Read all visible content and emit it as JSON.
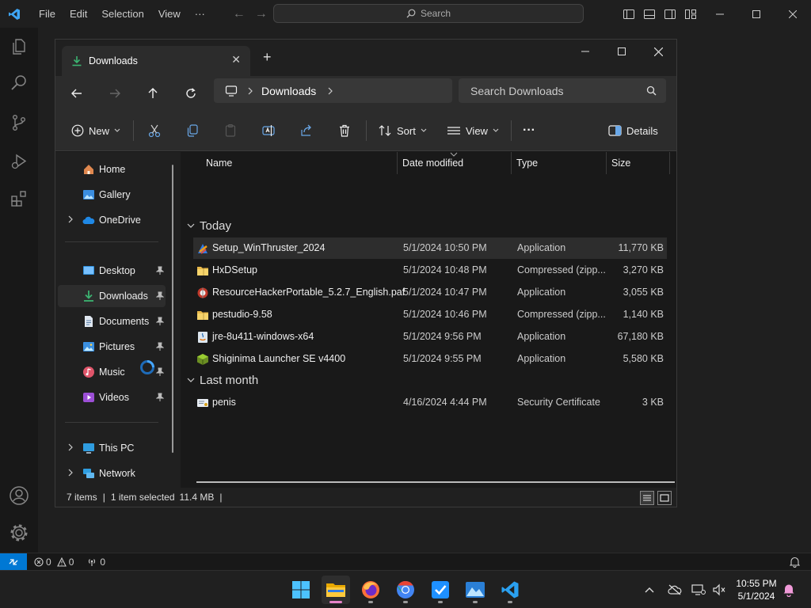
{
  "vscode": {
    "menu": [
      "File",
      "Edit",
      "Selection",
      "View",
      "···"
    ],
    "search_placeholder": "Search",
    "status": {
      "errors": "0",
      "warnings": "0",
      "ports": "0"
    }
  },
  "explorer": {
    "tab_title": "Downloads",
    "breadcrumb": "Downloads",
    "search_placeholder": "Search Downloads",
    "toolbar": {
      "new_label": "New",
      "sort_label": "Sort",
      "view_label": "View",
      "more_label": "···",
      "details_label": "Details"
    },
    "nav": {
      "home": "Home",
      "gallery": "Gallery",
      "onedrive": "OneDrive",
      "desktop": "Desktop",
      "downloads": "Downloads",
      "documents": "Documents",
      "pictures": "Pictures",
      "music": "Music",
      "videos": "Videos",
      "thispc": "This PC",
      "network": "Network"
    },
    "columns": {
      "name": "Name",
      "date": "Date modified",
      "type": "Type",
      "size": "Size"
    },
    "groups": [
      {
        "label": "Today",
        "files": [
          {
            "name": "Setup_WinThruster_2024",
            "date": "5/1/2024 10:50 PM",
            "type": "Application",
            "size": "11,770 KB",
            "icon": "setup-app-icon"
          },
          {
            "name": "HxDSetup",
            "date": "5/1/2024 10:48 PM",
            "type": "Compressed (zipp...",
            "size": "3,270 KB",
            "icon": "zip-folder-icon"
          },
          {
            "name": "ResourceHackerPortable_5.2.7_English.paf",
            "date": "5/1/2024 10:47 PM",
            "type": "Application",
            "size": "3,055 KB",
            "icon": "portable-app-icon"
          },
          {
            "name": "pestudio-9.58",
            "date": "5/1/2024 10:46 PM",
            "type": "Compressed (zipp...",
            "size": "1,140 KB",
            "icon": "zip-folder-icon"
          },
          {
            "name": "jre-8u411-windows-x64",
            "date": "5/1/2024 9:56 PM",
            "type": "Application",
            "size": "67,180 KB",
            "icon": "java-installer-icon"
          },
          {
            "name": "Shiginima Launcher SE v4400",
            "date": "5/1/2024 9:55 PM",
            "type": "Application",
            "size": "5,580 KB",
            "icon": "launcher-cube-icon"
          }
        ]
      },
      {
        "label": "Last month",
        "files": [
          {
            "name": "penis",
            "date": "4/16/2024 4:44 PM",
            "type": "Security Certificate",
            "size": "3 KB",
            "icon": "certificate-icon"
          }
        ]
      }
    ],
    "status": {
      "count": "7 items",
      "selection": "1 item selected",
      "size": "11.4 MB"
    }
  },
  "taskbar": {
    "time": "10:55 PM",
    "date": "5/1/2024"
  }
}
